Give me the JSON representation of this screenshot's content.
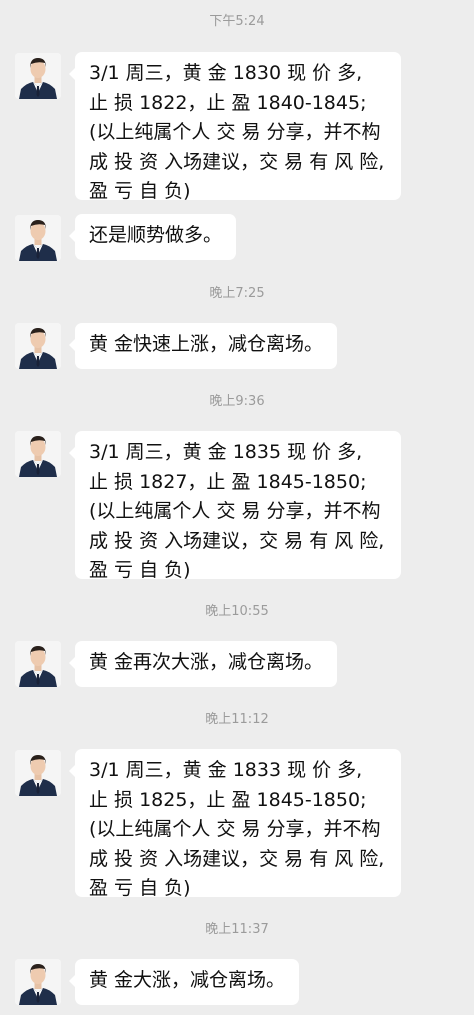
{
  "chat": {
    "messages": [
      {
        "type": "timestamp",
        "text": "下午5:24"
      },
      {
        "type": "text",
        "text": "3/1 周三，黄 金 1830 现 价 多,\n止 损 1822，止 盈 1840-1845;\n(以上纯属个人 交 易 分享，并不构\n成 投 资 入场建议，交 易 有 风 险,\n盈 亏 自 负)"
      },
      {
        "type": "text",
        "text": "还是顺势做多。"
      },
      {
        "type": "timestamp",
        "text": "晚上7:25"
      },
      {
        "type": "text",
        "text": "黄 金快速上涨，减仓离场。"
      },
      {
        "type": "timestamp",
        "text": "晚上9:36"
      },
      {
        "type": "text",
        "text": "3/1 周三，黄 金 1835 现 价 多,\n止 损 1827，止 盈 1845-1850;\n(以上纯属个人 交 易 分享，并不构\n成 投 资 入场建议，交 易 有 风 险,\n盈 亏 自 负)"
      },
      {
        "type": "timestamp",
        "text": "晚上10:55"
      },
      {
        "type": "text",
        "text": "黄 金再次大涨，减仓离场。"
      },
      {
        "type": "timestamp",
        "text": "晚上11:12"
      },
      {
        "type": "text",
        "text": "3/1 周三，黄 金 1833 现 价 多,\n止 损 1825，止 盈 1845-1850;\n(以上纯属个人 交 易 分享，并不构\n成 投 资 入场建议，交 易 有 风 险,\n盈 亏 自 负)"
      },
      {
        "type": "timestamp",
        "text": "晚上11:37"
      },
      {
        "type": "text",
        "text": "黄 金大涨，减仓离场。"
      }
    ]
  },
  "colors": {
    "background": "#ededed",
    "bubble": "#ffffff",
    "timestamp_text": "#9b9b9b",
    "message_text": "#111111"
  },
  "icons": {
    "avatar": "avatar-icon"
  }
}
